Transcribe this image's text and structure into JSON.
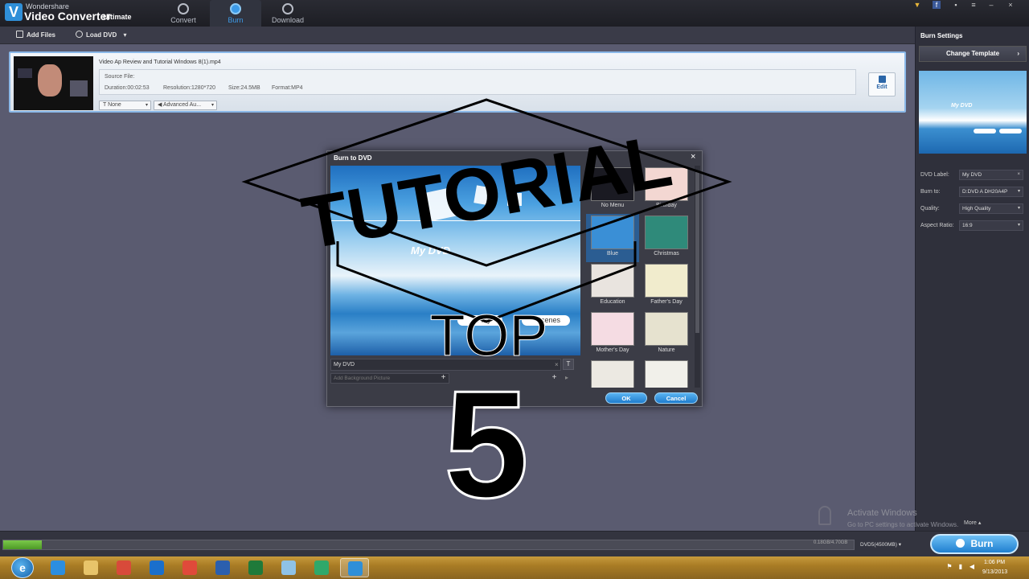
{
  "app": {
    "brand_company": "Wondershare",
    "brand_name": "Video Converter",
    "brand_edition": "Ultimate",
    "tabs": [
      {
        "label": "Convert",
        "active": false
      },
      {
        "label": "Burn",
        "active": true
      },
      {
        "label": "Download",
        "active": false
      }
    ],
    "window_controls": {
      "minimize": "–",
      "close": "×"
    }
  },
  "toolbar": {
    "add_files": "Add Files",
    "load_dvd": "Load DVD"
  },
  "file_item": {
    "title": "Video Ap Review and Tutorial Windows 8(1).mp4",
    "source_label": "Source File:",
    "duration": "Duration:00:02:53",
    "resolution": "Resolution:1280*720",
    "size": "Size:24.5MB",
    "format": "Format:MP4",
    "subtitle_select": "T None",
    "audio_select": "◀ Advanced Au...",
    "edit_label": "Edit"
  },
  "burn_settings": {
    "title": "Burn Settings",
    "change_template": "Change Template",
    "preview_label": "My DVD",
    "fields": [
      {
        "label": "DVD Label:",
        "value": "My DVD"
      },
      {
        "label": "Burn to:",
        "value": "D:DVD A  DH20A4P"
      },
      {
        "label": "Quality:",
        "value": "High Quality"
      },
      {
        "label": "Aspect Ratio:",
        "value": "16:9"
      }
    ],
    "more": "More"
  },
  "dialog": {
    "title": "Burn to DVD",
    "close": "×",
    "preview_title": "My DVD",
    "preview_buttons": [
      "Play",
      "Scenes"
    ],
    "label_value": "My DVD",
    "bg_placeholder": "Add Background Picture",
    "templates": [
      {
        "name": "No Menu",
        "color": "#1a1a22"
      },
      {
        "name": "Birthday",
        "color": "#f3d7d2"
      },
      {
        "name": "Blue",
        "color": "#3a8fd6",
        "selected": true
      },
      {
        "name": "Christmas",
        "color": "#2f8a7a"
      },
      {
        "name": "Education",
        "color": "#e9e4df"
      },
      {
        "name": "Father's Day",
        "color": "#f1eccd"
      },
      {
        "name": "Mother's Day",
        "color": "#f5dce3"
      },
      {
        "name": "Nature",
        "color": "#e6e2cf"
      },
      {
        "name": "",
        "color": "#ece9e2"
      },
      {
        "name": "",
        "color": "#f1f0ea"
      }
    ],
    "ok": "OK",
    "cancel": "Cancel"
  },
  "bottom": {
    "progress": 0.045,
    "size_text": "0.18GB/4.70GB",
    "disc_type": "DVD5(4500MB)",
    "burn": "Burn"
  },
  "activation": {
    "title": "Activate Windows",
    "subtitle": "Go to PC settings to activate Windows."
  },
  "overlay": {
    "line1": "TUTORIAL",
    "line2": "TOP",
    "line3": "5"
  },
  "taskbar": {
    "time": "1:06 PM",
    "date": "9/13/2013",
    "apps": [
      {
        "name": "internet-explorer",
        "color": "#2c8ee0"
      },
      {
        "name": "file-explorer",
        "color": "#e8c46a"
      },
      {
        "name": "media-center",
        "color": "#d84a3a"
      },
      {
        "name": "teamviewer",
        "color": "#1a6fcc"
      },
      {
        "name": "chrome",
        "color": "#e04a3a"
      },
      {
        "name": "word",
        "color": "#2b5fae"
      },
      {
        "name": "excel",
        "color": "#1f7a3a"
      },
      {
        "name": "notepad",
        "color": "#8fc2e6"
      },
      {
        "name": "app-green",
        "color": "#2fa86a"
      },
      {
        "name": "video-converter",
        "color": "#2f8fd8",
        "active": true
      }
    ]
  }
}
